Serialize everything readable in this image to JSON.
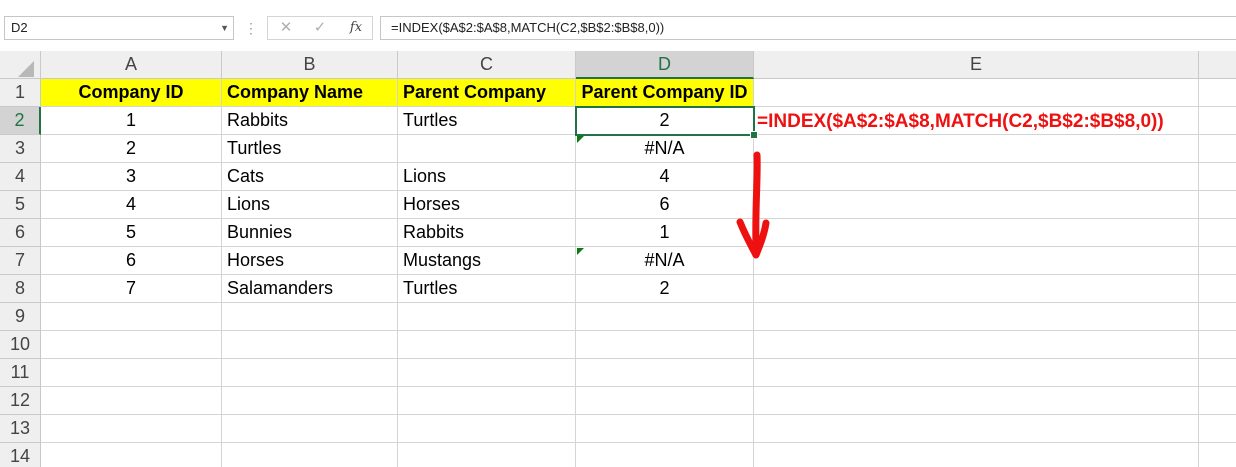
{
  "formula_bar": {
    "name_box": "D2",
    "formula": "=INDEX($A$2:$A$8,MATCH(C2,$B$2:$B$8,0))",
    "cancel_glyph": "✕",
    "enter_glyph": "✓",
    "fx_label": "fx"
  },
  "grid": {
    "columns": [
      "A",
      "B",
      "C",
      "D",
      "E"
    ],
    "rows": [
      "1",
      "2",
      "3",
      "4",
      "5",
      "6",
      "7",
      "8",
      "9",
      "10",
      "11",
      "12",
      "13",
      "14"
    ],
    "headers": {
      "company_id": "Company ID",
      "company_name": "Company Name",
      "parent_company": "Parent Company",
      "parent_company_id": "Parent Company ID"
    },
    "data": [
      {
        "id": "1",
        "name": "Rabbits",
        "parent": "Turtles",
        "parent_id": "2"
      },
      {
        "id": "2",
        "name": "Turtles",
        "parent": "",
        "parent_id": "#N/A"
      },
      {
        "id": "3",
        "name": "Cats",
        "parent": "Lions",
        "parent_id": "4"
      },
      {
        "id": "4",
        "name": "Lions",
        "parent": "Horses",
        "parent_id": "6"
      },
      {
        "id": "5",
        "name": "Bunnies",
        "parent": "Rabbits",
        "parent_id": "1"
      },
      {
        "id": "6",
        "name": "Horses",
        "parent": "Mustangs",
        "parent_id": "#N/A"
      },
      {
        "id": "7",
        "name": "Salamanders",
        "parent": "Turtles",
        "parent_id": "2"
      }
    ],
    "selected_cell": "D2"
  },
  "annotation": {
    "formula": "=INDEX($A$2:$A$8,MATCH(C2,$B$2:$B$8,0))",
    "color": "#ee1111"
  },
  "colors": {
    "header_fill": "#ffff00",
    "selection": "#217346",
    "error_indicator": "#0a7a12"
  }
}
